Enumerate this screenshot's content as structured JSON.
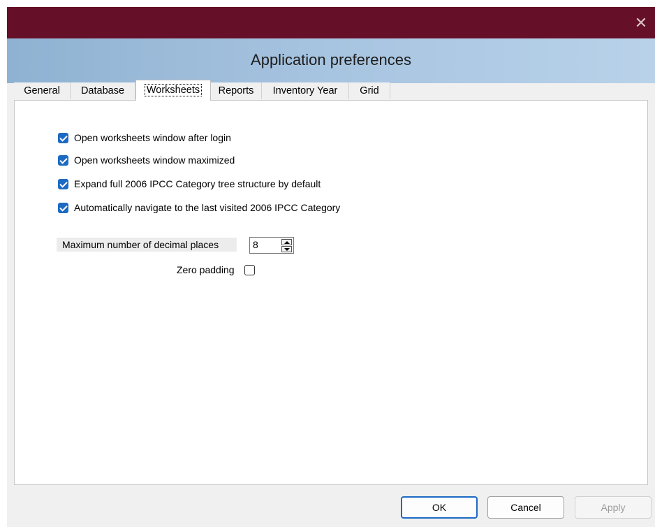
{
  "window": {
    "close_glyph": "✕",
    "title": "Application preferences"
  },
  "tabs": [
    {
      "label": "General"
    },
    {
      "label": "Database"
    },
    {
      "label": "Worksheets",
      "active": true
    },
    {
      "label": "Reports"
    },
    {
      "label": "Inventory Year"
    },
    {
      "label": "Grid"
    }
  ],
  "worksheets": {
    "options": [
      {
        "label": "Open worksheets window after login",
        "checked": true
      },
      {
        "label": "Open worksheets window maximized",
        "checked": true
      },
      {
        "label": "Expand full 2006 IPCC Category tree structure by default",
        "checked": true
      },
      {
        "label": "Automatically navigate to the last visited 2006 IPCC Category",
        "checked": true
      }
    ],
    "decimal_places_label": "Maximum number of decimal places",
    "decimal_places_value": "8",
    "zero_padding_label": "Zero padding",
    "zero_padding_checked": false
  },
  "buttons": {
    "ok": "OK",
    "cancel": "Cancel",
    "apply": "Apply"
  },
  "colors": {
    "titlebar": "#650f28",
    "accent": "#1d6ac3"
  }
}
